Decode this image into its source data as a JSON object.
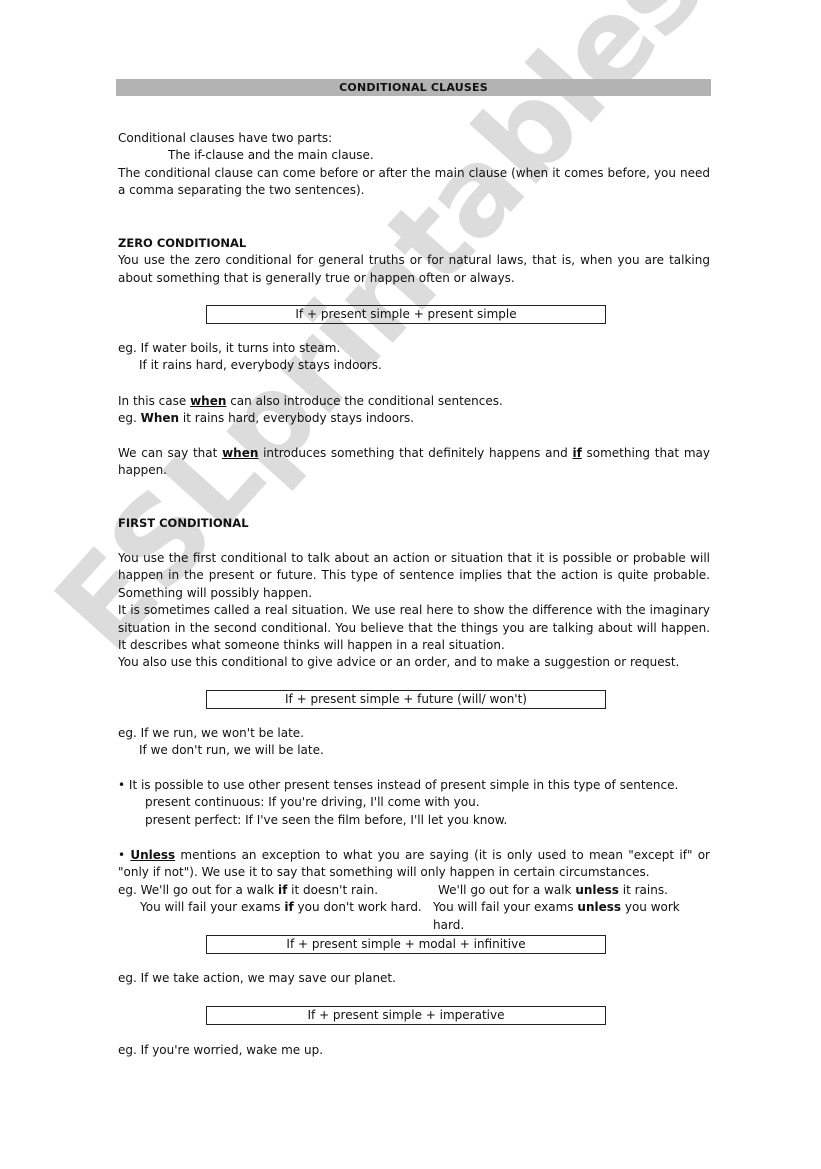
{
  "title": "CONDITIONAL CLAUSES",
  "watermark": "ESLprintables.com",
  "intro": {
    "line1": "Conditional clauses have two parts:",
    "line2": "The if-clause and the main clause.",
    "line3": "The conditional clause can come before or after the main clause (when it comes before, you need a comma separating the two sentences)."
  },
  "zero": {
    "heading": "ZERO CONDITIONAL",
    "description": "You use the zero conditional for general truths or for natural laws, that is, when you are talking about something that is generally true or happen often or always.",
    "formula": "If + present simple + present simple",
    "example1": "eg. If water boils, it turns into steam.",
    "example2": "If it rains hard, everybody stays indoors.",
    "when_note_pre": "In this case ",
    "when_word": "when",
    "when_note_post": " can also introduce the conditional sentences.",
    "when_eg_pre": "eg. ",
    "when_eg_word": "When",
    "when_eg_post": " it rains hard, everybody stays indoors.",
    "diff_pre": "We can say that ",
    "diff_when": "when",
    "diff_mid": " introduces something that definitely happens and ",
    "diff_if": "if",
    "diff_post": " something that may happen."
  },
  "first": {
    "heading": "FIRST CONDITIONAL",
    "para1": "You use the first conditional to talk about an action or situation that it is possible or probable will happen in the present or future. This type of sentence implies that the action is quite probable. Something will possibly happen.",
    "para2": "It is sometimes called a real situation. We use real here to show the difference with the imaginary situation in the second conditional. You believe that the things you are talking about will happen. It describes what someone thinks will happen in a real situation.",
    "para3": "You also use this conditional to give advice or an order, and to make a suggestion or request.",
    "formula1": "If + present simple + future (will/ won't)",
    "example1": "eg. If we run, we won't be late.",
    "example2": "If we don't run, we will be late.",
    "bullet1": "It is possible to use other present tenses instead of present simple in this type of sentence.",
    "bullet1_sub1": "present continuous: If you're driving, I'll come with you.",
    "bullet1_sub2": "present perfect: If I've seen the film before, I'll let you know.",
    "unless_word": "Unless",
    "unless_text": " mentions an exception to what you are saying (it is only used to mean \"except if\" or \"only if not\"). We use it to say that something will only happen in certain circumstances.",
    "unless_ex": [
      {
        "left_pre": "eg. We'll go out for a walk ",
        "left_bold": "if",
        "left_post": " it doesn't rain.",
        "right_pre": "We'll go out for a walk ",
        "right_bold": "unless",
        "right_post": " it rains."
      },
      {
        "left_pre": "You will fail your exams ",
        "left_bold": "if",
        "left_post": " you don't work hard.",
        "right_pre": "You will fail your exams ",
        "right_bold": "unless",
        "right_post": " you work hard."
      }
    ],
    "formula2": "If + present simple + modal + infinitive",
    "example3": "eg. If we take action, we may save our planet.",
    "formula3": "If + present simple + imperative",
    "example4": "eg. If you're worried, wake me up."
  }
}
